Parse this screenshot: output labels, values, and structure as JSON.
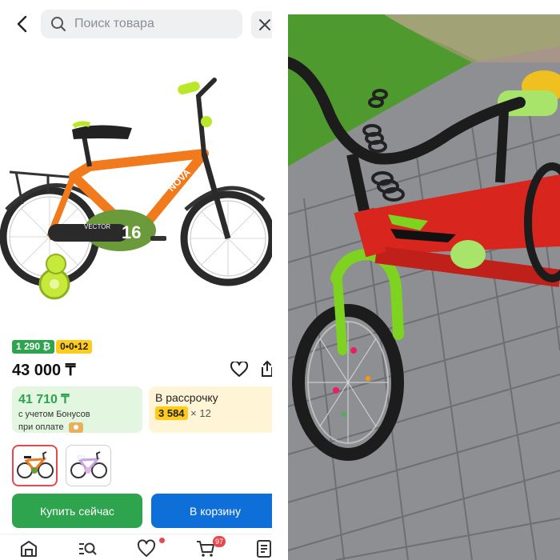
{
  "search": {
    "placeholder": "Поиск товара"
  },
  "badges": {
    "bonus": "1 290 ₿",
    "installment": "0•0•12"
  },
  "product": {
    "price": "43 000 ₸"
  },
  "bonus_card": {
    "amount": "41 710 ₸",
    "line1": "с учетом Бонусов",
    "line2": "при оплате"
  },
  "installment_card": {
    "title": "В рассрочку",
    "monthly": "3 584",
    "months": "× 12"
  },
  "actions": {
    "buy_now": "Купить сейчас",
    "add_to_cart": "В корзину"
  },
  "tabbar": {
    "cart_count": "97"
  },
  "bike": {
    "frame_labels": [
      "NOVA",
      "VECTOR"
    ],
    "wheel_size": "16"
  },
  "colors": {
    "brand_green": "#2ea44f",
    "brand_blue": "#0f6fd8",
    "accent_yellow": "#ffcc1a",
    "alert_red": "#e5484d"
  }
}
